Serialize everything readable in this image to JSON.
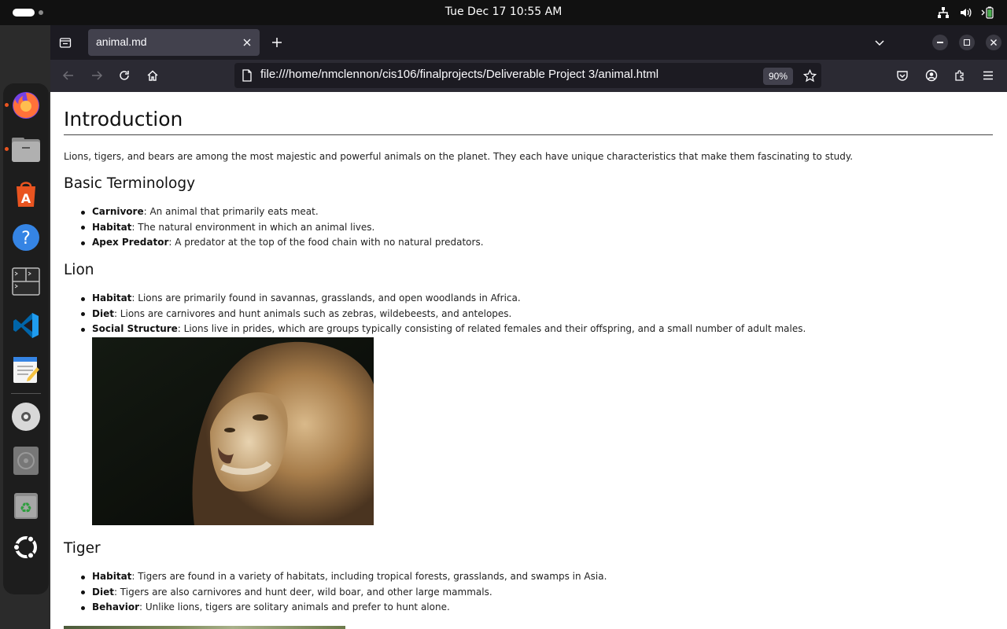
{
  "system": {
    "clock": "Tue Dec 17  10:55 AM"
  },
  "dock": {
    "apps": [
      {
        "name": "firefox-icon",
        "running": true
      },
      {
        "name": "files-icon",
        "running": true
      },
      {
        "name": "app-center-icon",
        "running": false
      },
      {
        "name": "help-icon",
        "running": false
      },
      {
        "name": "terminal-icon",
        "running": false
      },
      {
        "name": "vscode-icon",
        "running": false
      },
      {
        "name": "text-editor-icon",
        "running": false
      },
      {
        "name": "disc-icon",
        "running": false
      },
      {
        "name": "disc-drive-icon",
        "running": false
      },
      {
        "name": "trash-icon",
        "running": false
      },
      {
        "name": "ubuntu-icon",
        "running": false
      }
    ]
  },
  "browser": {
    "tab_title": "animal.md",
    "url": "file:///home/nmclennon/cis106/finalprojects/Deliverable Project 3/animal.html",
    "zoom": "90%"
  },
  "page": {
    "title": "Introduction",
    "intro": "Lions, tigers, and bears are among the most majestic and powerful animals on the planet. They each have unique characteristics that make them fascinating to study.",
    "sections": [
      {
        "heading": "Basic Terminology",
        "items": [
          {
            "term": "Carnivore",
            "text": ": An animal that primarily eats meat."
          },
          {
            "term": "Habitat",
            "text": ": The natural environment in which an animal lives."
          },
          {
            "term": "Apex Predator",
            "text": ": A predator at the top of the food chain with no natural predators."
          }
        ]
      },
      {
        "heading": "Lion",
        "items": [
          {
            "term": "Habitat",
            "text": ": Lions are primarily found in savannas, grasslands, and open woodlands in Africa."
          },
          {
            "term": "Diet",
            "text": ": Lions are carnivores and hunt animals such as zebras, wildebeests, and antelopes."
          },
          {
            "term": "Social Structure",
            "text": ": Lions live in prides, which are groups typically consisting of related females and their offspring, and a small number of adult males."
          }
        ]
      },
      {
        "heading": "Tiger",
        "items": [
          {
            "term": "Habitat",
            "text": ": Tigers are found in a variety of habitats, including tropical forests, grasslands, and swamps in Asia."
          },
          {
            "term": "Diet",
            "text": ": Tigers are also carnivores and hunt deer, wild boar, and other large mammals."
          },
          {
            "term": "Behavior",
            "text": ": Unlike lions, tigers are solitary animals and prefer to hunt alone."
          }
        ]
      }
    ]
  }
}
